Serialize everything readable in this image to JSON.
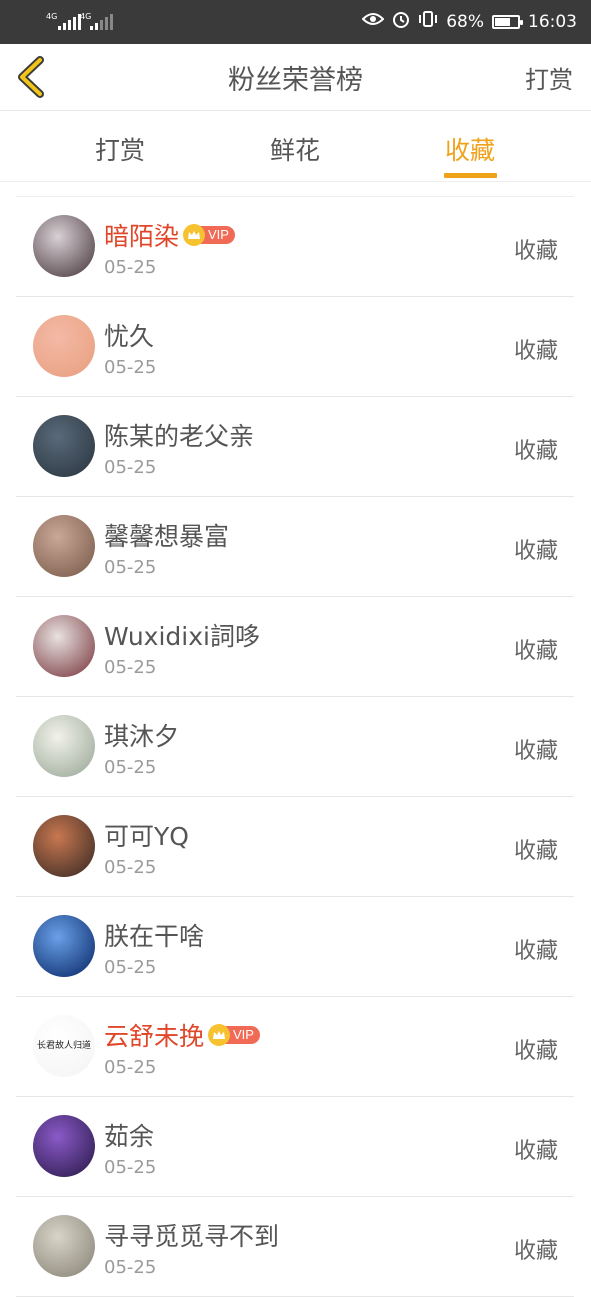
{
  "statusbar": {
    "net1": "4G",
    "net2": "4G",
    "battery_percent_text": "68%",
    "battery_level": 0.68,
    "time": "16:03"
  },
  "header": {
    "title": "粉丝荣誉榜",
    "right_label": "打赏",
    "back_icon": "chevron-left-icon"
  },
  "tabs": {
    "items": [
      "打赏",
      "鲜花",
      "收藏"
    ],
    "active_index": 2,
    "active_color": "#f0a21b"
  },
  "badge": {
    "vip_text": "VIP"
  },
  "fans": [
    {
      "name": "暗陌染",
      "vip": true,
      "date": "05-25",
      "action": "收藏",
      "avatar_colors": [
        "#d8d0d4",
        "#4a3a40"
      ]
    },
    {
      "name": "忧久",
      "vip": false,
      "date": "05-25",
      "action": "收藏",
      "avatar_colors": [
        "#f4b9a6",
        "#e8a080"
      ]
    },
    {
      "name": "陈某的老父亲",
      "vip": false,
      "date": "05-25",
      "action": "收藏",
      "avatar_colors": [
        "#5a6a7a",
        "#2a3540"
      ]
    },
    {
      "name": "馨馨想暴富",
      "vip": false,
      "date": "05-25",
      "action": "收藏",
      "avatar_colors": [
        "#c9a898",
        "#7a5a4a"
      ]
    },
    {
      "name": "Wuxidixi詞哆",
      "vip": false,
      "date": "05-25",
      "action": "收藏",
      "avatar_colors": [
        "#e8e2e0",
        "#7a3a40"
      ]
    },
    {
      "name": "琪沐夕",
      "vip": false,
      "date": "05-25",
      "action": "收藏",
      "avatar_colors": [
        "#f2f2ea",
        "#9aa898"
      ]
    },
    {
      "name": "可可YQ",
      "vip": false,
      "date": "05-25",
      "action": "收藏",
      "avatar_colors": [
        "#c87850",
        "#3a2a24"
      ]
    },
    {
      "name": "朕在干啥",
      "vip": false,
      "date": "05-25",
      "action": "收藏",
      "avatar_colors": [
        "#6aa0e8",
        "#0a2a6a"
      ]
    },
    {
      "name": "云舒未挽",
      "vip": true,
      "date": "05-25",
      "action": "收藏",
      "avatar_colors": [
        "#ffffff",
        "#f4f4f4"
      ],
      "avatar_text": "长君故人归道"
    },
    {
      "name": "茹余",
      "vip": false,
      "date": "05-25",
      "action": "收藏",
      "avatar_colors": [
        "#8a5ac8",
        "#2a1a4a"
      ]
    },
    {
      "name": "寻寻觅觅寻不到",
      "vip": false,
      "date": "05-25",
      "action": "收藏",
      "avatar_colors": [
        "#d8d4c8",
        "#8a8478"
      ]
    }
  ],
  "colors": {
    "vip_name": "#e0472a",
    "normal_name": "#555555",
    "date": "#9a9a9a",
    "vip_tag": "#f06a55",
    "crown": "#f7c230"
  }
}
